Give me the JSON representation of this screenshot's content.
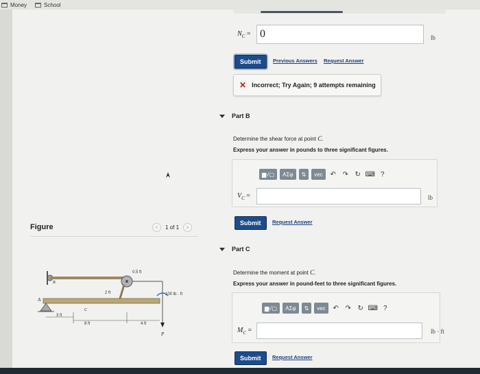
{
  "bookmarks": [
    {
      "label": "Money"
    },
    {
      "label": "School"
    }
  ],
  "partA": {
    "label": "N",
    "sub": "C",
    "eq": "=",
    "value": "0",
    "unit": "lb",
    "submit": "Submit",
    "previous_answers": "Previous Answers",
    "request_answer": "Request Answer",
    "feedback": "Incorrect; Try Again; 9 attempts remaining"
  },
  "partB": {
    "title": "Part B",
    "prompt_prefix": "Determine the shear force at point ",
    "prompt_point": "C",
    "prompt_suffix": ".",
    "instruction": "Express your answer in pounds to three significant figures.",
    "label": "V",
    "sub": "C",
    "eq": "=",
    "value": "",
    "unit": "lb",
    "submit": "Submit",
    "request_answer": "Request Answer"
  },
  "partC": {
    "title": "Part C",
    "prompt_prefix": "Determine the moment at point ",
    "prompt_point": "C",
    "prompt_suffix": ".",
    "instruction": "Express your answer in pound-feet to three significant figures.",
    "label": "M",
    "sub": "C",
    "eq": "=",
    "value": "",
    "unit": "lb · ft",
    "submit": "Submit",
    "request_answer": "Request Answer"
  },
  "toolbar": {
    "templates": "▆√▢",
    "greek": "ΑΣφ",
    "arrows": "⇅",
    "vec": "vec",
    "help": "?"
  },
  "figure": {
    "label": "Figure",
    "pager": "1 of 1",
    "prev": "<",
    "next": ">",
    "dim_top": "0.5 ft",
    "dim_2ft": "2 ft",
    "moment": "100 lb · ft",
    "dim_3ft": "3 ft",
    "dim_8ft": "8 ft",
    "dim_4ft": "4 ft",
    "pt_A": "A",
    "pt_B": "B",
    "pt_C": "C",
    "force": "P"
  },
  "colors": {
    "submit": "#1c4c8a",
    "link": "#1c3f7a",
    "error": "#b71c1c",
    "toolbar_button": "#7d8a94"
  }
}
